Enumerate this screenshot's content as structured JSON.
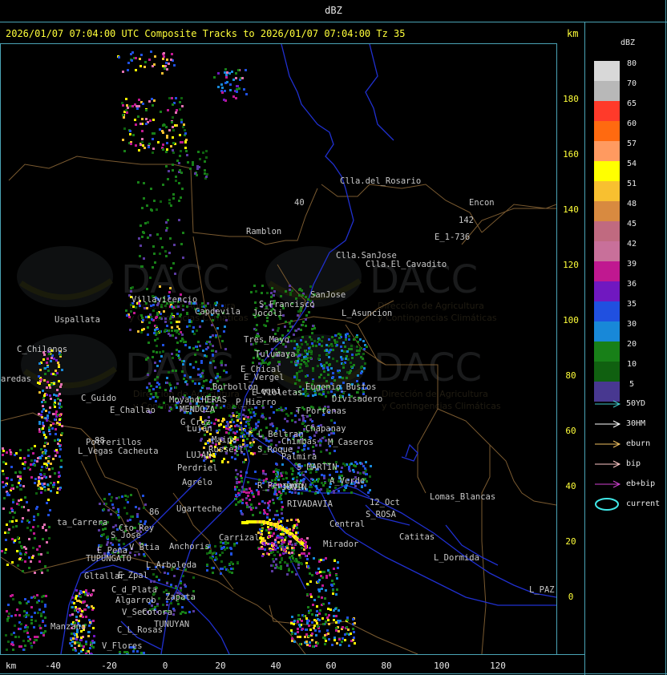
{
  "window_title": "dBZ",
  "header": "2026/01/07 07:04:00 UTC Composite Tracks to 2026/01/07 07:04:00 Tz 35",
  "axis_unit": "km",
  "y_ticks": [
    "180",
    "160",
    "140",
    "120",
    "100",
    "80",
    "60",
    "40",
    "20",
    "0"
  ],
  "x_ticks": [
    "-40",
    "-20",
    "0",
    "20",
    "40",
    "60",
    "80",
    "100",
    "120"
  ],
  "legend": {
    "title": "dBZ",
    "levels": [
      {
        "label": "80",
        "color": "#d8d8d8"
      },
      {
        "label": "70",
        "color": "#b8b8b8"
      },
      {
        "label": "65",
        "color": "#ff3a2a"
      },
      {
        "label": "60",
        "color": "#ff6a10"
      },
      {
        "label": "57",
        "color": "#ff9a60"
      },
      {
        "label": "54",
        "color": "#ffff00"
      },
      {
        "label": "51",
        "color": "#f8c030"
      },
      {
        "label": "48",
        "color": "#d88a40"
      },
      {
        "label": "45",
        "color": "#c06a80"
      },
      {
        "label": "42",
        "color": "#c8709a"
      },
      {
        "label": "39",
        "color": "#c01890"
      },
      {
        "label": "36",
        "color": "#7018c0"
      },
      {
        "label": "35",
        "color": "#2050e0"
      },
      {
        "label": "30",
        "color": "#1888d8"
      },
      {
        "label": "20",
        "color": "#188018"
      },
      {
        "label": "10",
        "color": "#106010"
      },
      {
        "label": "5",
        "color": "#483890"
      }
    ]
  },
  "tracks": [
    {
      "label": "50YD",
      "color": "#40c8c8"
    },
    {
      "label": "30HM",
      "color": "#ffffff"
    },
    {
      "label": "eburn",
      "color": "#f0c060"
    },
    {
      "label": "bip",
      "color": "#ffc8c8"
    },
    {
      "label": "eb+bip",
      "color": "#d040d0"
    }
  ],
  "current_label": "current",
  "current_color": "#40e8e8",
  "watermark": {
    "text": "DACC",
    "sub1": "Dirección de Agricultura",
    "sub2": "y Contingencias Climáticas"
  },
  "places": [
    {
      "name": "Clla.del_Rosario"
    },
    {
      "name": "Encon"
    },
    {
      "name": "142"
    },
    {
      "name": "E_1-736"
    },
    {
      "name": "Ramblon"
    },
    {
      "name": "Clla.SanJose"
    },
    {
      "name": "Clla.El_Cavadito"
    },
    {
      "name": "Villavicencio"
    },
    {
      "name": "S_Francisco"
    },
    {
      "name": "SanJose"
    },
    {
      "name": "Capdevila"
    },
    {
      "name": "Jocoli"
    },
    {
      "name": "L_Asuncion"
    },
    {
      "name": "Uspallata"
    },
    {
      "name": "Tres_Mayo"
    },
    {
      "name": "C_Chilenos"
    },
    {
      "name": "Tulumaya"
    },
    {
      "name": "E_Chical"
    },
    {
      "name": "E_Vergel"
    },
    {
      "name": "Borbollon"
    },
    {
      "name": "Leoni"
    },
    {
      "name": "Moyano"
    },
    {
      "name": "aredas"
    },
    {
      "name": "E_Violetas"
    },
    {
      "name": "Eugenio_Bustos"
    },
    {
      "name": "Divisadero"
    },
    {
      "name": "C_Guido"
    },
    {
      "name": "LHERAS"
    },
    {
      "name": "P_Hierro"
    },
    {
      "name": "T_Portenas"
    },
    {
      "name": "E_Challao"
    },
    {
      "name": "MENDOZA"
    },
    {
      "name": "G_Cruz"
    },
    {
      "name": "Lujan"
    },
    {
      "name": "F_L_Beltran"
    },
    {
      "name": "Chapanay"
    },
    {
      "name": "Chimbas"
    },
    {
      "name": "M_Caseros"
    },
    {
      "name": "Potrerillos"
    },
    {
      "name": "Maipu"
    },
    {
      "name": "S_Roque"
    },
    {
      "name": "Palmira"
    },
    {
      "name": "L_Vegas"
    },
    {
      "name": "Cacheuta"
    },
    {
      "name": "LUJAN"
    },
    {
      "name": "Russell"
    },
    {
      "name": "Perdriel"
    },
    {
      "name": "S_MARTIN"
    },
    {
      "name": "A_Verde"
    },
    {
      "name": "Agrelo"
    },
    {
      "name": "R_Pensado"
    },
    {
      "name": "JUNIN"
    },
    {
      "name": "12_Oct"
    },
    {
      "name": "Lomas_Blancas"
    },
    {
      "name": "Ugarteche"
    },
    {
      "name": "RIVADAVIA"
    },
    {
      "name": "S_ROSA"
    },
    {
      "name": "ta_Carrera"
    },
    {
      "name": "Cto_Rey"
    },
    {
      "name": "S_Jose"
    },
    {
      "name": "Central"
    },
    {
      "name": "Catitas"
    },
    {
      "name": "Carrizal"
    },
    {
      "name": "Mirador"
    },
    {
      "name": "E_Pena"
    },
    {
      "name": "Anchoris"
    },
    {
      "name": "TUPUNGATO"
    },
    {
      "name": "V_Btia"
    },
    {
      "name": "L_Dormida"
    },
    {
      "name": "L_Arboleda"
    },
    {
      "name": "Gltallar"
    },
    {
      "name": "E_Zpal"
    },
    {
      "name": "L_PAZ"
    },
    {
      "name": "C_d_Plata"
    },
    {
      "name": "Algarrob"
    },
    {
      "name": "Zapata"
    },
    {
      "name": "V_Seco"
    },
    {
      "name": "Cotora"
    },
    {
      "name": "Manzano"
    },
    {
      "name": "TUNUYAN"
    },
    {
      "name": "C_L_Rosas"
    },
    {
      "name": "V_Flores"
    },
    {
      "name": "88"
    },
    {
      "name": "86"
    },
    {
      "name": "40"
    }
  ]
}
